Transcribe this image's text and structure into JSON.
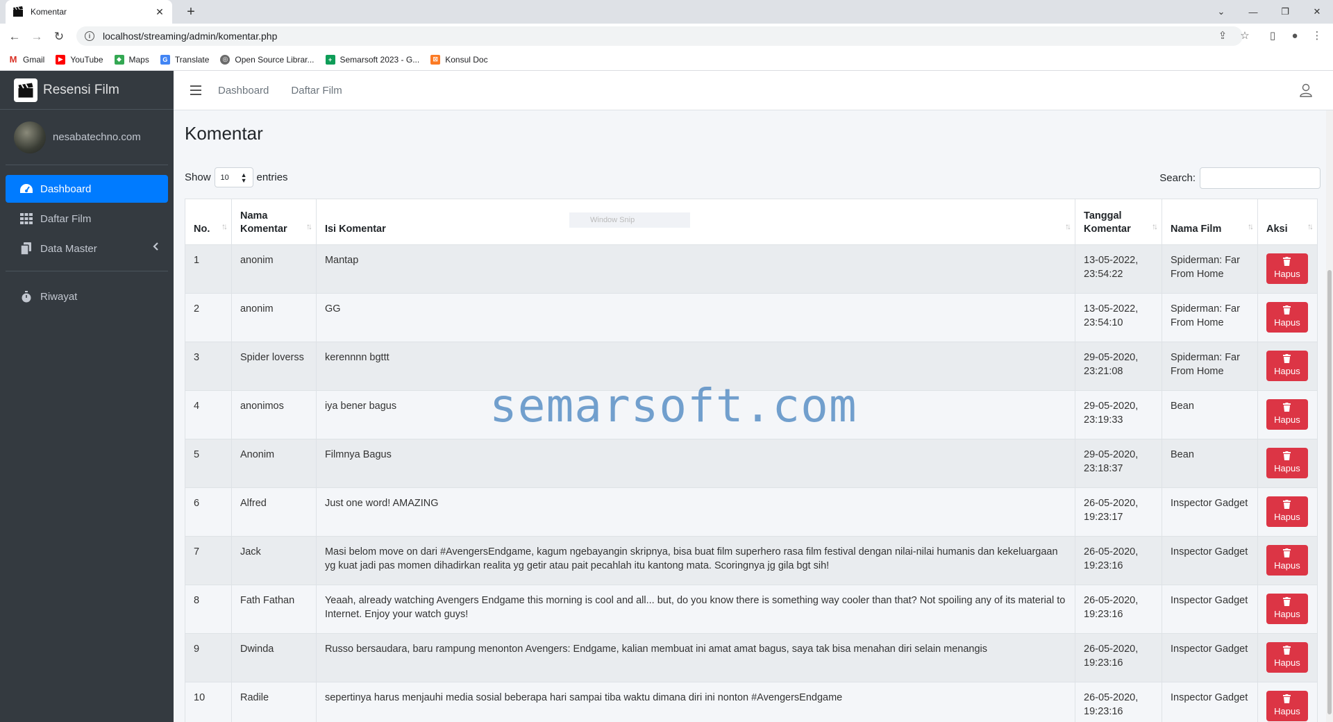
{
  "browser": {
    "tab_title": "Komentar",
    "url": "localhost/streaming/admin/komentar.php",
    "bookmarks": [
      "Gmail",
      "YouTube",
      "Maps",
      "Translate",
      "Open Source Librar...",
      "Semarsoft 2023 - G...",
      "Konsul Doc"
    ]
  },
  "sidebar": {
    "brand": "Resensi Film",
    "user": "nesabatechno.com",
    "items": [
      {
        "label": "Dashboard",
        "icon": "tachometer-icon",
        "active": true
      },
      {
        "label": "Daftar Film",
        "icon": "grid-icon"
      },
      {
        "label": "Data Master",
        "icon": "copy-icon"
      },
      {
        "label": "Riwayat",
        "icon": "stopwatch-icon"
      }
    ]
  },
  "topnav": {
    "links": [
      "Dashboard",
      "Daftar Film"
    ]
  },
  "page": {
    "title": "Komentar",
    "show_label": "Show",
    "entries_value": "10",
    "entries_label": "entries",
    "search_label": "Search:",
    "snip_text": "Window Snip",
    "watermark": "semarsoft.com"
  },
  "table": {
    "headers": [
      "No.",
      "Nama Komentar",
      "Isi Komentar",
      "Tanggal Komentar",
      "Nama Film",
      "Aksi"
    ],
    "action_label": "Hapus",
    "rows": [
      {
        "no": "1",
        "nama": "anonim",
        "isi": "Mantap",
        "tgl": "13-05-2022, 23:54:22",
        "film": "Spiderman: Far From Home"
      },
      {
        "no": "2",
        "nama": "anonim",
        "isi": "GG",
        "tgl": "13-05-2022, 23:54:10",
        "film": "Spiderman: Far From Home"
      },
      {
        "no": "3",
        "nama": "Spider loverss",
        "isi": "kerennnn bgttt",
        "tgl": "29-05-2020, 23:21:08",
        "film": "Spiderman: Far From Home"
      },
      {
        "no": "4",
        "nama": "anonimos",
        "isi": "iya bener bagus",
        "tgl": "29-05-2020, 23:19:33",
        "film": "Bean"
      },
      {
        "no": "5",
        "nama": "Anonim",
        "isi": "Filmnya Bagus",
        "tgl": "29-05-2020, 23:18:37",
        "film": "Bean"
      },
      {
        "no": "6",
        "nama": "Alfred",
        "isi": "Just one word! AMAZING",
        "tgl": "26-05-2020, 19:23:17",
        "film": "Inspector Gadget"
      },
      {
        "no": "7",
        "nama": "Jack",
        "isi": "Masi belom move on dari #AvengersEndgame, kagum ngebayangin skripnya, bisa buat film superhero rasa film festival dengan nilai-nilai humanis dan kekeluargaan yg kuat jadi pas momen dihadirkan realita yg getir atau pait pecahlah itu kantong mata. Scoringnya jg gila bgt sih!",
        "tgl": "26-05-2020, 19:23:16",
        "film": "Inspector Gadget"
      },
      {
        "no": "8",
        "nama": "Fath Fathan",
        "isi": "Yeaah, already watching Avengers Endgame this morning is cool and all... but, do you know there is something way cooler than that? Not spoiling any of its material to Internet. Enjoy your watch guys!",
        "tgl": "26-05-2020, 19:23:16",
        "film": "Inspector Gadget"
      },
      {
        "no": "9",
        "nama": "Dwinda",
        "isi": "Russo bersaudara, baru rampung menonton Avengers: Endgame, kalian membuat ini amat amat bagus, saya tak bisa menahan diri selain menangis",
        "tgl": "26-05-2020, 19:23:16",
        "film": "Inspector Gadget"
      },
      {
        "no": "10",
        "nama": "Radile",
        "isi": "sepertinya harus menjauhi media sosial beberapa hari sampai tiba waktu dimana diri ini nonton #AvengersEndgame",
        "tgl": "26-05-2020, 19:23:16",
        "film": "Inspector Gadget"
      }
    ]
  }
}
